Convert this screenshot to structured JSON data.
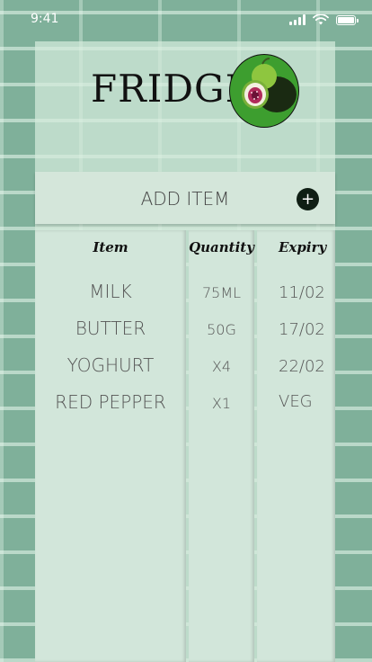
{
  "status_bar": {
    "time": "9:41"
  },
  "header": {
    "title": "FRIDGE",
    "logo_icon": "fig-icon"
  },
  "add_item": {
    "label": "ADD ITEM",
    "button_symbol": "+"
  },
  "table": {
    "columns": [
      "Item",
      "Quantity",
      "Expiry"
    ],
    "rows": [
      {
        "item": "MILK",
        "quantity": "75ML",
        "expiry": "11/02"
      },
      {
        "item": "BUTTER",
        "quantity": "50G",
        "expiry": "17/02"
      },
      {
        "item": "YOGHURT",
        "quantity": "X4",
        "expiry": "22/02"
      },
      {
        "item": "RED PEPPER",
        "quantity": "X1",
        "expiry": "VEG"
      }
    ]
  },
  "colors": {
    "accent": "#0f1e14",
    "logo_green": "#3d9e2f",
    "background": "#7fb09a"
  }
}
